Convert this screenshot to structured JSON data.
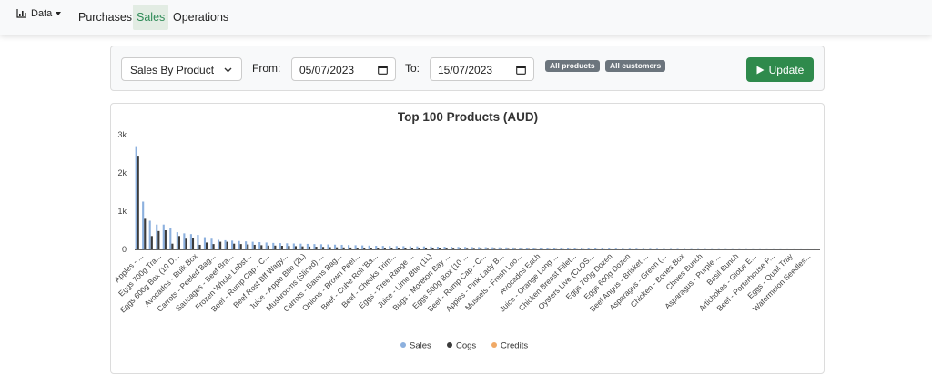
{
  "navbar": {
    "brand_label": "Data",
    "links": [
      {
        "label": "Purchases",
        "active": false
      },
      {
        "label": "Sales",
        "active": true
      },
      {
        "label": "Operations",
        "active": false
      }
    ]
  },
  "filters": {
    "report_select": "Sales By Product",
    "from_label": "From:",
    "from_value": "05/07/2023",
    "to_label": "To:",
    "to_value": "15/07/2023",
    "product_badge": "All products",
    "customer_badge": "All customers",
    "update_label": "Update"
  },
  "colors": {
    "sales": "#8cb0de",
    "cogs": "#3b3b3b",
    "credits": "#f0a966",
    "accent": "#2f8a4c"
  },
  "chart_data": {
    "type": "bar",
    "title": "Top 100 Products (AUD)",
    "xlabel": "",
    "ylabel": "",
    "ylim": [
      0,
      3000
    ],
    "yticks": [
      0,
      1000,
      2000,
      3000
    ],
    "ytick_labels": [
      "0",
      "1k",
      "2k",
      "3k"
    ],
    "legend_position": "bottom",
    "series": [
      {
        "name": "Sales",
        "values": [
          2700,
          1250,
          750,
          650,
          650,
          560,
          450,
          420,
          400,
          380,
          320,
          280,
          250,
          240,
          230,
          220,
          210,
          200,
          190,
          180,
          170,
          165,
          160,
          155,
          150,
          145,
          140,
          135,
          130,
          125,
          120,
          115,
          110,
          105,
          100,
          95,
          92,
          90,
          88,
          85,
          82,
          80,
          78,
          75,
          72,
          70,
          68,
          66,
          64,
          62,
          60,
          58,
          56,
          54,
          52,
          50,
          48,
          46,
          44,
          42,
          40,
          38,
          36,
          34,
          32,
          30,
          28,
          26,
          24,
          22,
          20,
          19,
          18,
          17,
          16,
          15,
          14,
          13,
          12,
          11,
          10,
          9,
          8,
          8,
          7,
          7,
          6,
          6,
          5,
          5,
          4,
          4,
          3,
          3,
          3,
          2,
          2,
          2,
          1,
          1
        ]
      },
      {
        "name": "Cogs",
        "values": [
          2450,
          800,
          350,
          480,
          500,
          150,
          350,
          280,
          300,
          120,
          180,
          140,
          200,
          200,
          150,
          140,
          130,
          120,
          110,
          100,
          100,
          95,
          90,
          85,
          80,
          75,
          70,
          65,
          60,
          55,
          52,
          50,
          48,
          46,
          44,
          42,
          40,
          38,
          36,
          34,
          32,
          30,
          28,
          26,
          24,
          22,
          20,
          18,
          17,
          16,
          15,
          14,
          13,
          12,
          11,
          10,
          9,
          8,
          7,
          6,
          5,
          5,
          4,
          4,
          3,
          3,
          2,
          2,
          2,
          1,
          1,
          1,
          1,
          1,
          1,
          0,
          0,
          0,
          0,
          0,
          0,
          0,
          0,
          0,
          0,
          0,
          0,
          0,
          0,
          0,
          0,
          0,
          0,
          0,
          0,
          0,
          0,
          0,
          0,
          0
        ]
      },
      {
        "name": "Credits",
        "values": [
          0,
          0,
          0,
          0,
          0,
          0,
          0,
          0,
          0,
          0,
          0,
          0,
          0,
          0,
          0,
          0,
          0,
          0,
          0,
          0,
          0,
          0,
          0,
          0,
          0,
          0,
          0,
          0,
          0,
          0,
          0,
          0,
          0,
          0,
          0,
          0,
          0,
          0,
          0,
          0,
          0,
          0,
          0,
          0,
          0,
          0,
          0,
          0,
          0,
          0,
          0,
          0,
          0,
          0,
          0,
          0,
          0,
          0,
          0,
          0,
          0,
          0,
          0,
          0,
          0,
          0,
          0,
          0,
          0,
          0,
          0,
          0,
          0,
          0,
          0,
          0,
          0,
          0,
          0,
          0,
          0,
          0,
          0,
          0,
          0,
          0,
          0,
          0,
          0,
          0,
          0,
          0,
          0,
          0,
          0,
          0,
          0,
          0,
          0,
          0
        ]
      }
    ],
    "category_labels": [
      "Apples - ...",
      "Eggs 700g Tra...",
      "Eggs 600g Box (10 D...",
      "Avocados - Bulk Box",
      "Carrots - Peeled Bag...",
      "Sausages - Beef Bra...",
      "Frozen Whole Lobst...",
      "Beef - Rump Cap - C...",
      "Beef Rost Bff Wagy...",
      "Juice - Apple Btle (2L)",
      "Mushrooms (Sliced) ...",
      "Carrots - Batons Bag...",
      "Onions - Brown Peel...",
      "Beef - Cube Roll 'Ba...",
      "Beef - Cheeks Trim...",
      "Eggs - Free Range ...",
      "Juice - Lime Btle (1L)",
      "Bugs - Moreton Bay ...",
      "Eggs 500g Box (10 ...",
      "Beef - Rump Cap - C...",
      "Apples - Pink Lady B...",
      "Mussels - Fresh Loo...",
      "Avocados Each",
      "Juice - Orange Long ...",
      "Chicken Breast Fillet...",
      "Oysters Live (CLOS...",
      "Eggs 700g Dozen",
      "Eggs 600g Dozen",
      "Beef Angus - Brisket ...",
      "Asparagus - Green (...",
      "Chicken - Bones Box",
      "Chives Bunch",
      "Asparagus - Purple ...",
      "Basil Bunch",
      "Artichokes - Globe E...",
      "Beef - Porterhouse P...",
      "Eggs - Quail Tray",
      "Watermelon Seedles..."
    ]
  }
}
